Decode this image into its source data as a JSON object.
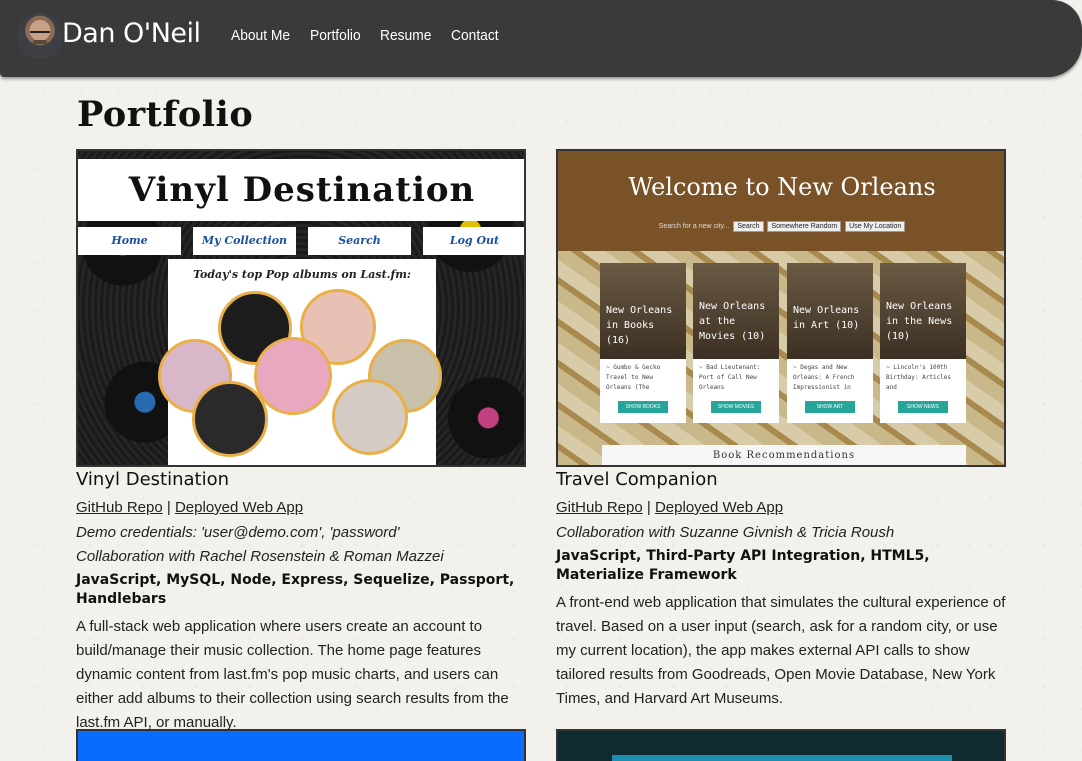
{
  "nav": {
    "brand": "Dan O'Neil",
    "links": [
      "About Me",
      "Portfolio",
      "Resume",
      "Contact"
    ]
  },
  "page": {
    "title": "Portfolio"
  },
  "projects": [
    {
      "title": "Vinyl Destination",
      "repo_label": "GitHub Repo",
      "separator": "|",
      "app_label": "Deployed Web App",
      "credentials": "Demo credentials: 'user@demo.com', 'password'",
      "collab": "Collaboration with Rachel Rosenstein & Roman Mazzei",
      "tech": "JavaScript, MySQL, Node, Express, Sequelize, Passport, Handlebars",
      "description": "A full-stack web application where users create an account to build/manage their music collection. The home page features dynamic content from last.fm's pop music charts, and users can either add albums to their collection using search results from the last.fm API, or manually.",
      "screenshot": {
        "header": "Vinyl Destination",
        "nav": [
          "Home",
          "My Collection",
          "Search",
          "Log Out"
        ],
        "panel_title": "Today's top Pop albums on Last.fm:"
      }
    },
    {
      "title": "Travel Companion",
      "repo_label": "GitHub Repo",
      "separator": "|",
      "app_label": "Deployed Web App",
      "collab": "Collaboration with Suzanne Givnish & Tricia Roush",
      "tech": "JavaScript, Third-Party API Integration, HTML5, Materialize Framework",
      "description": "A front-end web application that simulates the cultural experience of travel. Based on a user input (search, ask for a random city, or use my current location), the app makes external API calls to show tailored results from Goodreads, Open Movie Database, New York Times, and Harvard Art Museums.",
      "screenshot": {
        "header": "Welcome to New Orleans",
        "search_text": "Search for a new city...",
        "buttons": [
          "Search",
          "Somewhere Random",
          "Use My Location"
        ],
        "cards": [
          {
            "overlay": "New Orleans in Books (16)",
            "snippet": "~ Gumbo & Gecko Travel to New Orleans (The",
            "button": "SHOW BOOKS"
          },
          {
            "overlay": "New Orleans at the Movies (10)",
            "snippet": "~ Bad Lieutenant: Port of Call New Orleans",
            "button": "SHOW MOVIES"
          },
          {
            "overlay": "New Orleans in Art (10)",
            "snippet": "~ Degas and New Orleans: A French Impressionist in",
            "button": "SHOW ART"
          },
          {
            "overlay": "New Orleans in the News (10)",
            "snippet": "~ Lincoln's 100th Birthday: Articles and",
            "button": "SHOW NEWS"
          }
        ],
        "footer": "Book Recommendations"
      }
    }
  ],
  "colors": {
    "navbar": "#3a3a3a",
    "accent_teal": "#26a69a",
    "page_bg": "#f3f1ec"
  }
}
